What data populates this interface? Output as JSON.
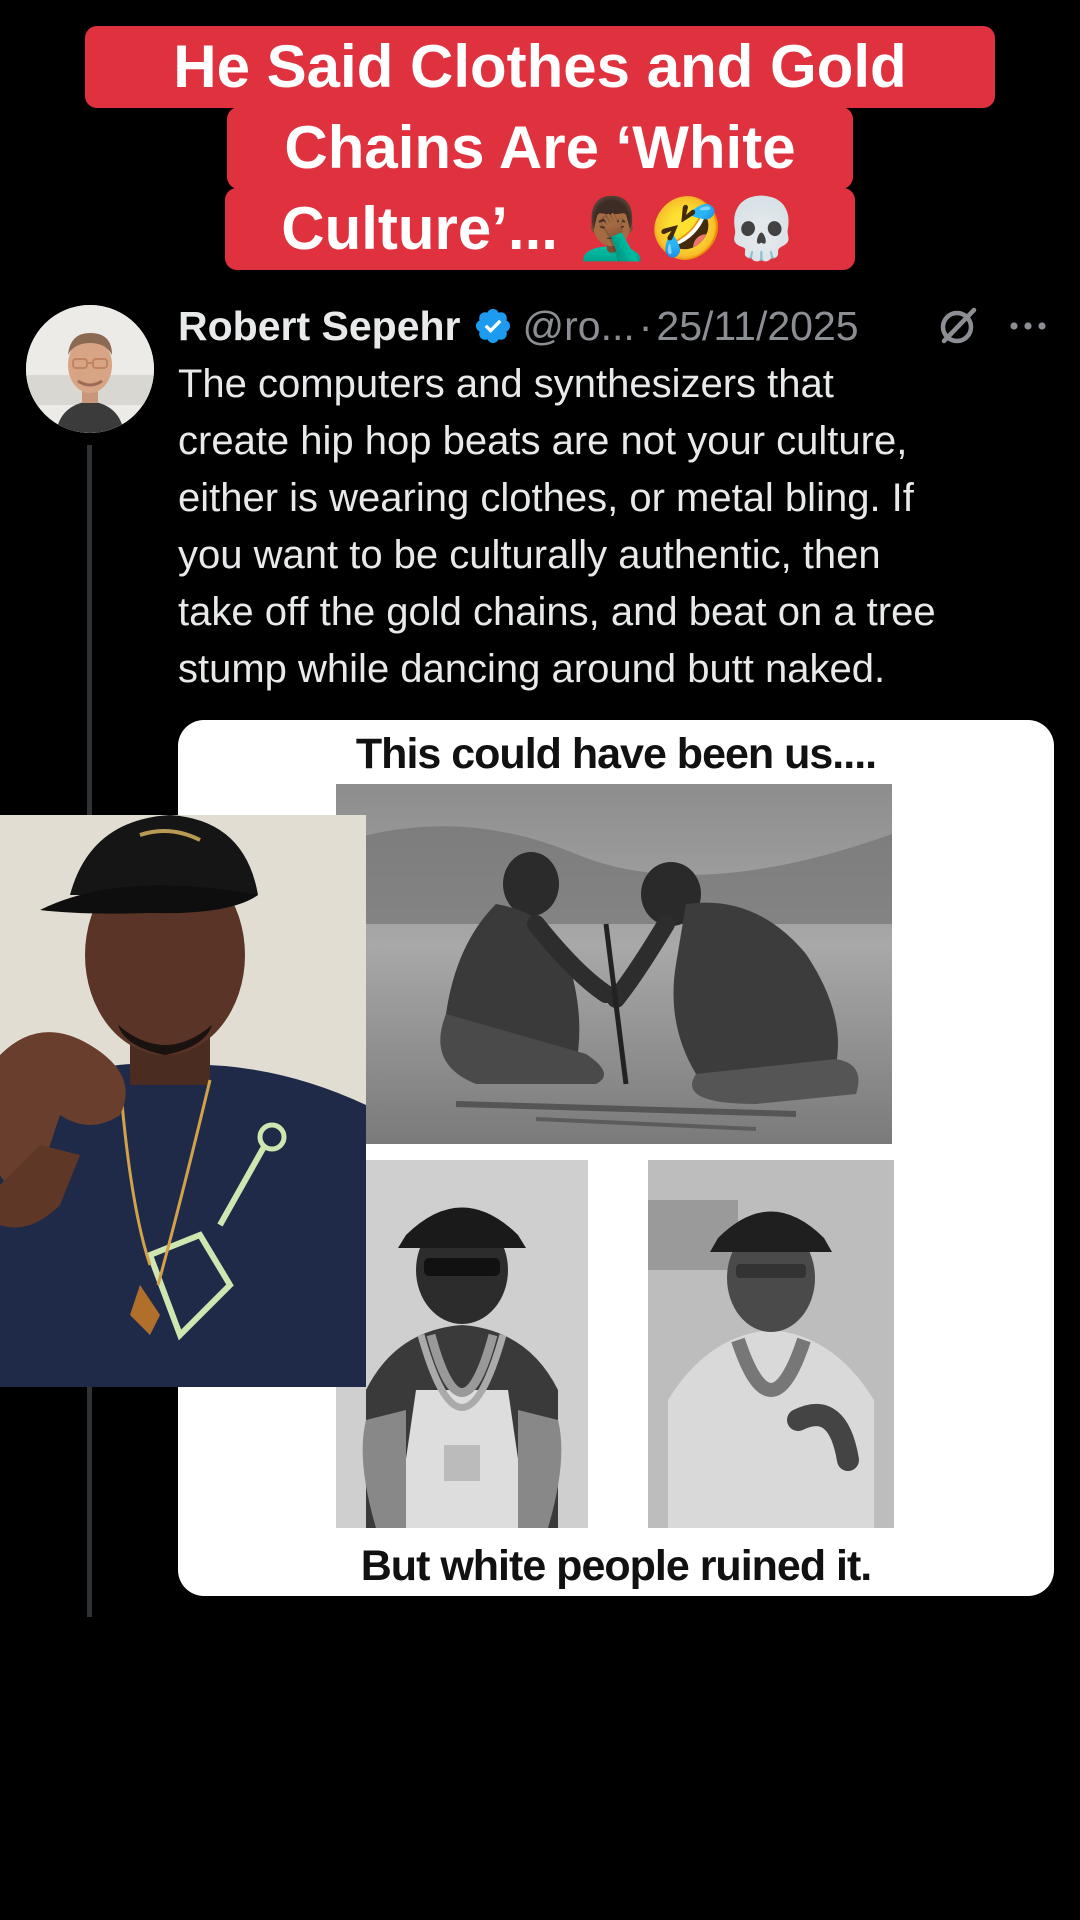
{
  "caption": {
    "lines": [
      "He Said Clothes and Gold",
      "Chains Are ‘White",
      "Culture’... 🤦🏾‍♂️🤣💀"
    ]
  },
  "tweet": {
    "author_name": "Robert Sepehr",
    "verified": true,
    "handle": "@ro...",
    "separator": "·",
    "date": "25/11/2025",
    "text": "The computers and synthesizers that\ncreate hip hop beats are not your culture,\neither is wearing clothes, or metal bling. If\nyou want to be culturally authentic, then\ntake off the gold chains, and beat on a tree\nstump while dancing around butt naked."
  },
  "meme": {
    "top_text": "This could have been us....",
    "bottom_text": "But white people ruined it."
  },
  "icons": {
    "verified": "verified-badge-icon",
    "grok": "grok-icon",
    "more": "more-icon"
  },
  "colors": {
    "caption_bg": "#e0313f",
    "verified": "#1d9bf0",
    "background": "#000000"
  }
}
